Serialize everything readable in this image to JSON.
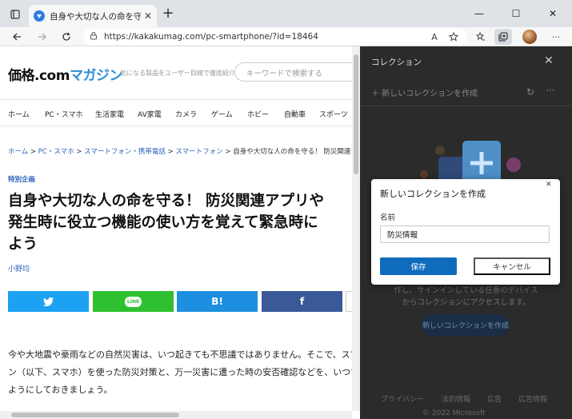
{
  "browser": {
    "tab": {
      "title": "自身や大切な人の命を守る！ 防災",
      "close": "✕"
    },
    "newtab": "+",
    "url": "https://kakakumag.com/pc-smartphone/?id=18464",
    "read_aloud": "A",
    "window_controls": {
      "minimize": "—",
      "maximize": "☐",
      "close": "✕"
    }
  },
  "site": {
    "logo_main": "価格.com",
    "logo_mag": "マガジン",
    "tagline": "気になる製品をユーザー目線で徹底紹介",
    "search_placeholder": "キーワードで検索する",
    "nav": [
      "ホーム",
      "PC・スマホ",
      "生活家電",
      "AV家電",
      "カメラ",
      "ゲーム",
      "ホビー",
      "自動車",
      "スポーツ"
    ],
    "breadcrumb": {
      "links": [
        "ホーム",
        "PC・スマホ",
        "スマートフォン・携帯電話",
        "スマートフォン"
      ],
      "separator": " > ",
      "current": "自身や大切な人の命を守る！ 防災関連アプリや災害"
    },
    "kicker": "特別企画",
    "headline": [
      "自身や大切な人の命を守る！ 防災関連アプリや",
      "発生時に役立つ機能の使い方を覚えて緊急時に",
      "よう"
    ],
    "author": "小野均",
    "share": [
      {
        "label": "🐦",
        "color": "#1da1f2"
      },
      {
        "label": "LINE",
        "color": "#2fc02f"
      },
      {
        "label": "B!",
        "color": "#1e8fe0"
      },
      {
        "label": "f",
        "color": "#3b5998"
      }
    ],
    "body": [
      "今や大地震や豪雨などの自然災害は、いつ起きても不思議ではありません。そこで、スマ",
      "ン（以下、スマホ）を使った防災対策と、万一災害に遭った時の安否確認などを、いつで",
      "ようにしておきましょう。"
    ]
  },
  "collections": {
    "title": "コレクション",
    "close": "✕",
    "new_link": "＋ 新しいコレクションを作成",
    "refresh": "↻",
    "more": "···",
    "hint_lines": [
      "作し、サインインしている任意のデバイス",
      "からコレクションにアクセスします。"
    ],
    "create_button": "新しいコレクションを作成",
    "footer": [
      "プライバシー",
      "法的情報",
      "広告",
      "広告情報"
    ],
    "copyright": "© 2022 Microsoft"
  },
  "dialog": {
    "title": "新しいコレクションを作成",
    "close": "✕",
    "name_label": "名前",
    "name_value": "防災情報",
    "save": "保存",
    "cancel": "キャンセル"
  }
}
